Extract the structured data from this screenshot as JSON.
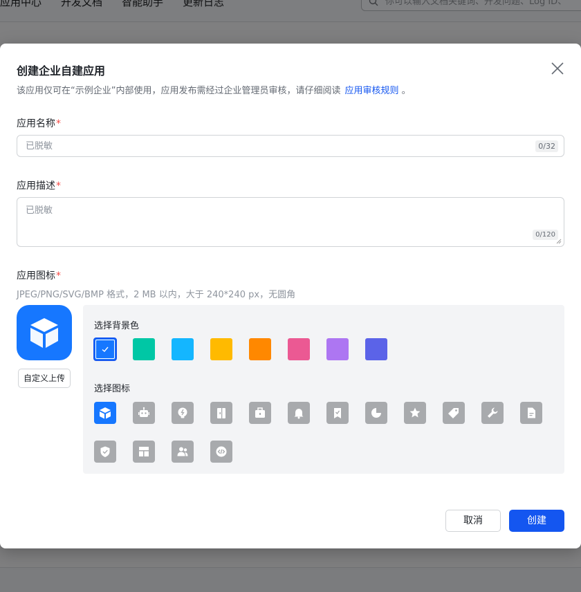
{
  "background": {
    "nav": [
      "应用中心",
      "开发文档",
      "智能助手",
      "更新日志"
    ],
    "search_placeholder": "你可以输入文档关键词、开发问题、Log ID、"
  },
  "modal": {
    "title": "创建企业自建应用",
    "description": "该应用仅可在“示例企业”内部使用，应用发布需经过企业管理员审核，请仔细阅读",
    "rules_link": "应用审核规则",
    "description_end": "。",
    "name_field": {
      "label": "应用名称",
      "required_mark": "*",
      "placeholder": "已脱敏",
      "counter": "0/32"
    },
    "desc_field": {
      "label": "应用描述",
      "required_mark": "*",
      "placeholder": "已脱敏",
      "counter": "0/120"
    },
    "icon_field": {
      "label": "应用图标",
      "required_mark": "*",
      "hint": "JPEG/PNG/SVG/BMP 格式，2 MB 以内，大于 240*240 px，无圆角",
      "upload_label": "自定义上传",
      "bg_color_label": "选择背景色",
      "bg_colors": [
        "#1677ff",
        "#00c7a5",
        "#14b6ff",
        "#ffba00",
        "#ff8800",
        "#eb5993",
        "#ad76f2",
        "#5b63e8"
      ],
      "selected_color": "#1677ff",
      "icon_label": "选择图标",
      "icons": [
        "cube-icon",
        "robot-icon",
        "bulb-icon",
        "door-icon",
        "toolbox-icon",
        "bell-icon",
        "bookmark-check-icon",
        "pie-chart-icon",
        "star-icon",
        "tag-icon",
        "wrench-icon",
        "document-icon",
        "shield-check-icon",
        "layout-icon",
        "users-icon",
        "code-icon"
      ],
      "selected_icon": "cube-icon"
    },
    "cancel_label": "取消",
    "create_label": "创建"
  }
}
